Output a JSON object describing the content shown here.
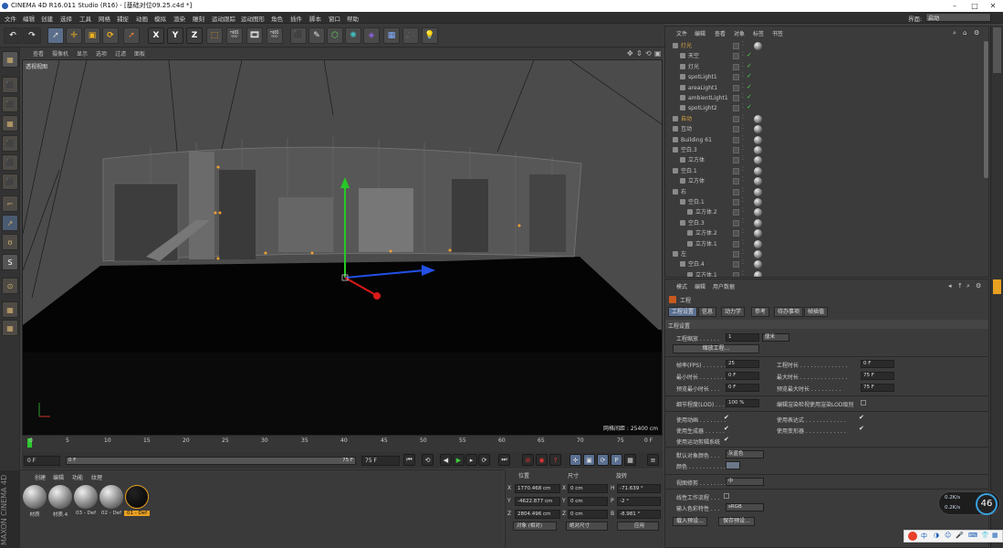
{
  "title": "CINEMA 4D R16.011 Studio (R16) - [基础对位09.25.c4d *]",
  "window_buttons": [
    "–",
    "□",
    "✕"
  ],
  "menu": [
    "文件",
    "编辑",
    "创建",
    "选择",
    "工具",
    "网格",
    "捕捉",
    "动画",
    "模拟",
    "渲染",
    "雕刻",
    "运动跟踪",
    "运动图形",
    "角色",
    "插件",
    "脚本",
    "窗口",
    "帮助"
  ],
  "layout": {
    "label": "界面:",
    "value": "启动"
  },
  "toolbar_axes": [
    "X",
    "Y",
    "Z"
  ],
  "viewport": {
    "menu": [
      "查看",
      "摄像机",
      "显示",
      "选项",
      "过滤",
      "面板"
    ],
    "label": "透视视图",
    "grid_spacing": "网格间距 : 25400 cm",
    "nav_icons": [
      "✥",
      "⇕",
      "⟲",
      "▣"
    ]
  },
  "timeline": {
    "ticks": [
      "0",
      "5",
      "10",
      "15",
      "20",
      "25",
      "30",
      "35",
      "40",
      "45",
      "50",
      "55",
      "60",
      "65",
      "70",
      "75"
    ],
    "end_frame": "0 F"
  },
  "playback": {
    "start": "0 F",
    "range_left": "0 F",
    "range_right": "75 F",
    "end": "75 F"
  },
  "materials": {
    "menu": [
      "创建",
      "编辑",
      "功能",
      "纹理"
    ],
    "items": [
      "材质",
      "材质.4",
      "03 - Def",
      "02 - Def",
      "01 - Def"
    ]
  },
  "coords": {
    "headers": [
      "位置",
      "尺寸",
      "旋转"
    ],
    "rows": [
      {
        "axis": "X",
        "pos": "1770.468 cm",
        "size": "0 cm",
        "rot_label": "H",
        "rot": "-71.639 °"
      },
      {
        "axis": "Y",
        "pos": "-4622.877 cm",
        "size": "0 cm",
        "rot_label": "P",
        "rot": "-2 °"
      },
      {
        "axis": "Z",
        "pos": "2804.496 cm",
        "size": "0 cm",
        "rot_label": "B",
        "rot": "-8.981 °"
      }
    ],
    "mode": "对象 (相对)",
    "size_mode": "绝对尺寸",
    "apply": "应用"
  },
  "objects": {
    "menu": [
      "文件",
      "编辑",
      "查看",
      "对象",
      "标签",
      "书签"
    ],
    "rows": [
      {
        "name": "灯光",
        "indent": 0,
        "color": "#d9a441"
      },
      {
        "name": "天空",
        "indent": 1,
        "color": "#c8c8c8"
      },
      {
        "name": "灯光",
        "indent": 1,
        "color": "#c8c8c8"
      },
      {
        "name": "spotLight1",
        "indent": 1,
        "color": "#c8c8c8"
      },
      {
        "name": "areaLight1",
        "indent": 1,
        "color": "#c8c8c8"
      },
      {
        "name": "ambientLight1",
        "indent": 1,
        "color": "#c8c8c8"
      },
      {
        "name": "spotLight2",
        "indent": 1,
        "color": "#c8c8c8"
      },
      {
        "name": "自动",
        "indent": 0,
        "color": "#d9a441"
      },
      {
        "name": "互动",
        "indent": 0,
        "color": "#c8c8c8"
      },
      {
        "name": "Building 61",
        "indent": 0,
        "color": "#c8c8c8"
      },
      {
        "name": "空白.3",
        "indent": 0,
        "color": "#c8c8c8"
      },
      {
        "name": "立方体",
        "indent": 1,
        "color": "#c8c8c8"
      },
      {
        "name": "空白.1",
        "indent": 0,
        "color": "#c8c8c8"
      },
      {
        "name": "立方体",
        "indent": 1,
        "color": "#c8c8c8"
      },
      {
        "name": "右",
        "indent": 0,
        "color": "#c8c8c8"
      },
      {
        "name": "空白.1",
        "indent": 1,
        "color": "#c8c8c8"
      },
      {
        "name": "立方体.2",
        "indent": 2,
        "color": "#c8c8c8"
      },
      {
        "name": "空白.3",
        "indent": 1,
        "color": "#c8c8c8"
      },
      {
        "name": "立方体.2",
        "indent": 2,
        "color": "#c8c8c8"
      },
      {
        "name": "立方体.1",
        "indent": 2,
        "color": "#c8c8c8"
      },
      {
        "name": "左",
        "indent": 0,
        "color": "#c8c8c8"
      },
      {
        "name": "空白.4",
        "indent": 1,
        "color": "#c8c8c8"
      },
      {
        "name": "立方体.1",
        "indent": 2,
        "color": "#c8c8c8"
      }
    ]
  },
  "attributes": {
    "menu": [
      "模式",
      "编辑",
      "用户数据"
    ],
    "object_label": "工程",
    "tabs": [
      "工程设置",
      "信息",
      "动力学",
      "参考",
      "待办事项",
      "帧插值"
    ],
    "section": "工程设置",
    "scale_label": "工程缩放 . . . . . .",
    "scale_value": "1",
    "scale_unit": "厘米",
    "scale_button": "缩放工程...",
    "fields": [
      {
        "label": "帧率(FPS) . . . . . . . .",
        "value": "25",
        "label2": "工程时长 . . . . . . . . . . . . . .",
        "value2": "0 F"
      },
      {
        "label": "最小时长 . . . . . . . . .",
        "value": "0 F",
        "label2": "最大时长 . . . . . . . . . . . . . .",
        "value2": "75 F"
      },
      {
        "label": "预览最小时长 . . .",
        "value": "0 F",
        "label2": "预览最大时长 . . . . . . . . .",
        "value2": "75 F"
      }
    ],
    "lod_label": "细节程度(LOD) . . .",
    "lod_value": "100 %",
    "lod_right": "编辑渲染检视使用渲染LOD级别",
    "checks_left": [
      "使用动画 . . . . . . . .",
      "使用生成器 . . . . . .",
      "使用运动剪辑系统"
    ],
    "checks_right": [
      "使用表达式 . . . . . . . . . . . .",
      "使用变形器 . . . . . . . . . . . ."
    ],
    "default_color_label": "默认对象颜色 . . .",
    "default_color": "灰蓝色",
    "color_label": "颜色 . . . . . . . . . . .",
    "view_clip_label": "视图修剪 . . . . . . . . .",
    "view_clip": "中",
    "linear_label": "线性工作流程 . . .",
    "input_profile_label": "输入色彩特性 . . .",
    "input_profile": "sRGB",
    "load_preset": "载入预设...",
    "save_preset": "保存预设..."
  },
  "network": {
    "up": "0.2K/s",
    "down": "0.2K/s",
    "percent": "46"
  },
  "taskbar": {
    "ime": "中"
  }
}
